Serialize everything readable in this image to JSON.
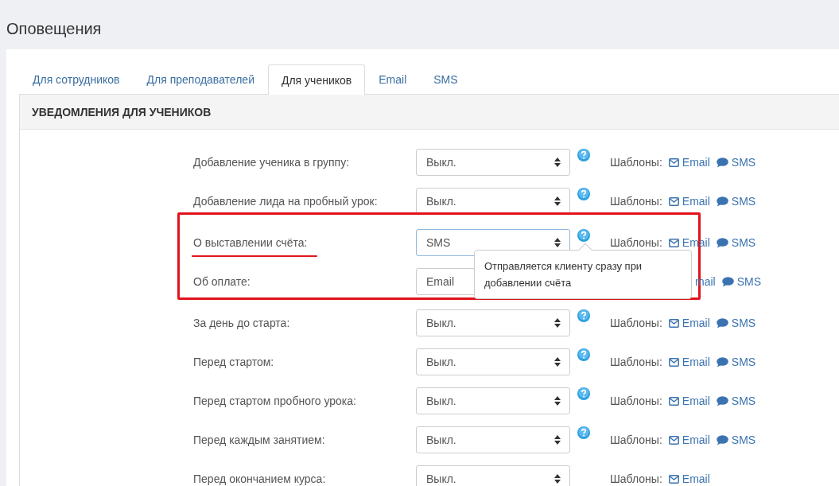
{
  "page_title": "Оповещения",
  "tabs": [
    {
      "label": "Для сотрудников",
      "selected": false
    },
    {
      "label": "Для преподавателей",
      "selected": false
    },
    {
      "label": "Для учеников",
      "selected": true
    },
    {
      "label": "Email",
      "selected": false
    },
    {
      "label": "SMS",
      "selected": false
    }
  ],
  "panel_title": "УВЕДОМЛЕНИЯ ДЛЯ УЧЕНИКОВ",
  "row_groups": [
    {
      "highlighted": false,
      "rows": [
        {
          "label": "Добавление ученика в группу:",
          "value": "Выкл.",
          "focused": false,
          "help": true,
          "templates_label": "Шаблоны:",
          "links": [
            {
              "kind": "email",
              "text": "Email"
            },
            {
              "kind": "sms",
              "text": "SMS"
            }
          ],
          "underlined": false
        },
        {
          "label": "Добавление лида на пробный урок:",
          "value": "Выкл.",
          "focused": false,
          "help": true,
          "templates_label": "Шаблоны:",
          "links": [
            {
              "kind": "email",
              "text": "Email"
            },
            {
              "kind": "sms",
              "text": "SMS"
            }
          ],
          "underlined": false
        }
      ]
    },
    {
      "highlighted": true,
      "rows": [
        {
          "label": "О выставлении счёта:",
          "value": "SMS",
          "focused": true,
          "help": true,
          "templates_label": "Шаблоны:",
          "links": [
            {
              "kind": "email",
              "text": "Email"
            },
            {
              "kind": "sms",
              "text": "SMS"
            }
          ],
          "underlined": true,
          "tooltip": "Отправляется клиенту сразу при добавлении счёта"
        },
        {
          "label": "Об оплате:",
          "value": "Email",
          "focused": false,
          "help": false,
          "links": [
            {
              "kind": "covered",
              "text": "mail"
            },
            {
              "kind": "sms",
              "text": "SMS"
            }
          ],
          "underlined": false
        }
      ]
    },
    {
      "highlighted": false,
      "rows": [
        {
          "label": "За день до старта:",
          "value": "Выкл.",
          "focused": false,
          "help": true,
          "templates_label": "Шаблоны:",
          "links": [
            {
              "kind": "email",
              "text": "Email"
            },
            {
              "kind": "sms",
              "text": "SMS"
            }
          ],
          "underlined": false
        },
        {
          "label": "Перед стартом:",
          "value": "Выкл.",
          "focused": false,
          "help": true,
          "templates_label": "Шаблоны:",
          "links": [
            {
              "kind": "email",
              "text": "Email"
            },
            {
              "kind": "sms",
              "text": "SMS"
            }
          ],
          "underlined": false
        },
        {
          "label": "Перед стартом пробного урока:",
          "value": "Выкл.",
          "focused": false,
          "help": true,
          "templates_label": "Шаблоны:",
          "links": [
            {
              "kind": "email",
              "text": "Email"
            },
            {
              "kind": "sms",
              "text": "SMS"
            }
          ],
          "underlined": false
        },
        {
          "label": "Перед каждым занятием:",
          "value": "Выкл.",
          "focused": false,
          "help": true,
          "templates_label": "Шаблоны:",
          "links": [
            {
              "kind": "email",
              "text": "Email"
            },
            {
              "kind": "sms",
              "text": "SMS"
            }
          ],
          "underlined": false
        },
        {
          "label": "Перед окончанием курса:",
          "value": "Выкл.",
          "focused": false,
          "help": false,
          "templates_label": "Шаблоны:",
          "links": [
            {
              "kind": "email",
              "text": "Email"
            }
          ],
          "underlined": false
        }
      ]
    }
  ]
}
